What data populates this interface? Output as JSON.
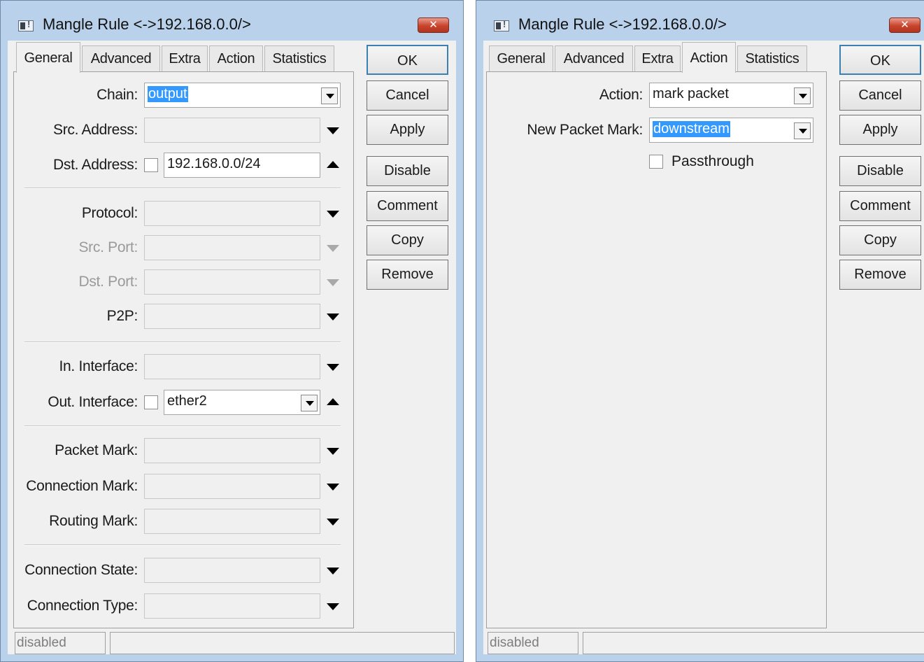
{
  "left_window": {
    "title": "Mangle Rule <->192.168.0.0/>",
    "close_glyph": "✕",
    "tabs": [
      "General",
      "Advanced",
      "Extra",
      "Action",
      "Statistics"
    ],
    "active_tab": "General",
    "fields": {
      "chain": {
        "label": "Chain:",
        "value": "output"
      },
      "src_address": {
        "label": "Src. Address:",
        "value": ""
      },
      "dst_address": {
        "label": "Dst. Address:",
        "value": "192.168.0.0/24",
        "negate": false
      },
      "protocol": {
        "label": "Protocol:",
        "value": ""
      },
      "src_port": {
        "label": "Src. Port:",
        "value": "",
        "disabled": true
      },
      "dst_port": {
        "label": "Dst. Port:",
        "value": "",
        "disabled": true
      },
      "p2p": {
        "label": "P2P:",
        "value": ""
      },
      "in_interface": {
        "label": "In. Interface:",
        "value": ""
      },
      "out_interface": {
        "label": "Out. Interface:",
        "value": "ether2",
        "negate": false
      },
      "packet_mark": {
        "label": "Packet Mark:",
        "value": ""
      },
      "connection_mark": {
        "label": "Connection Mark:",
        "value": ""
      },
      "routing_mark": {
        "label": "Routing Mark:",
        "value": ""
      },
      "connection_state": {
        "label": "Connection State:",
        "value": ""
      },
      "connection_type": {
        "label": "Connection Type:",
        "value": ""
      }
    },
    "buttons": {
      "ok": "OK",
      "cancel": "Cancel",
      "apply": "Apply",
      "disable": "Disable",
      "comment": "Comment",
      "copy": "Copy",
      "remove": "Remove"
    },
    "status": {
      "state": "disabled",
      "extra": ""
    }
  },
  "right_window": {
    "title": "Mangle Rule <->192.168.0.0/>",
    "close_glyph": "✕",
    "tabs": [
      "General",
      "Advanced",
      "Extra",
      "Action",
      "Statistics"
    ],
    "active_tab": "Action",
    "fields": {
      "action": {
        "label": "Action:",
        "value": "mark packet"
      },
      "new_packet_mark": {
        "label": "New Packet Mark:",
        "value": "downstream"
      },
      "passthrough": {
        "label": "Passthrough",
        "checked": false
      }
    },
    "buttons": {
      "ok": "OK",
      "cancel": "Cancel",
      "apply": "Apply",
      "disable": "Disable",
      "comment": "Comment",
      "copy": "Copy",
      "remove": "Remove"
    },
    "status": {
      "state": "disabled",
      "extra": ""
    }
  },
  "colors": {
    "title_bar": "#b9d1ea",
    "close_button": "#c8432c",
    "selection": "#3399ff",
    "panel": "#f0f0f0"
  }
}
